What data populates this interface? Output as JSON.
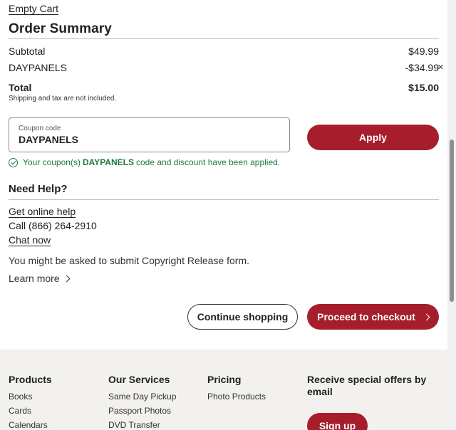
{
  "cart": {
    "empty_label": "Empty Cart"
  },
  "summary": {
    "title": "Order Summary",
    "subtotal_label": "Subtotal",
    "subtotal_value": "$49.99",
    "discount_label": "DAYPANELS",
    "discount_value": "-$34.99",
    "remove_icon": "×",
    "total_label": "Total",
    "total_value": "$15.00",
    "note": "Shipping and tax are not included."
  },
  "coupon": {
    "field_label": "Coupon code",
    "value": "DAYPANELS",
    "apply_label": "Apply",
    "msg_prefix": "Your coupon(s)",
    "msg_code": "DAYPANELS",
    "msg_suffix": "code and discount have been applied."
  },
  "help": {
    "title": "Need Help?",
    "online_help": "Get online help",
    "call": "Call (866) 264-2910",
    "chat": "Chat now"
  },
  "copyright": {
    "text": "You might be asked to submit Copyright Release form.",
    "learn_more": "Learn more"
  },
  "actions": {
    "continue": "Continue shopping",
    "checkout": "Proceed to checkout"
  },
  "footer": {
    "products": {
      "title": "Products",
      "items": [
        "Books",
        "Cards",
        "Calendars"
      ]
    },
    "services": {
      "title": "Our Services",
      "items": [
        "Same Day Pickup",
        "Passport Photos",
        "DVD Transfer"
      ]
    },
    "pricing": {
      "title": "Pricing",
      "items": [
        "Photo Products"
      ]
    },
    "offers": {
      "title": "Receive special offers by email",
      "signup": "Sign up"
    }
  },
  "colors": {
    "brand": "#a61e2c",
    "success": "#1f7a3a",
    "footer_bg": "#f3f1ee"
  }
}
